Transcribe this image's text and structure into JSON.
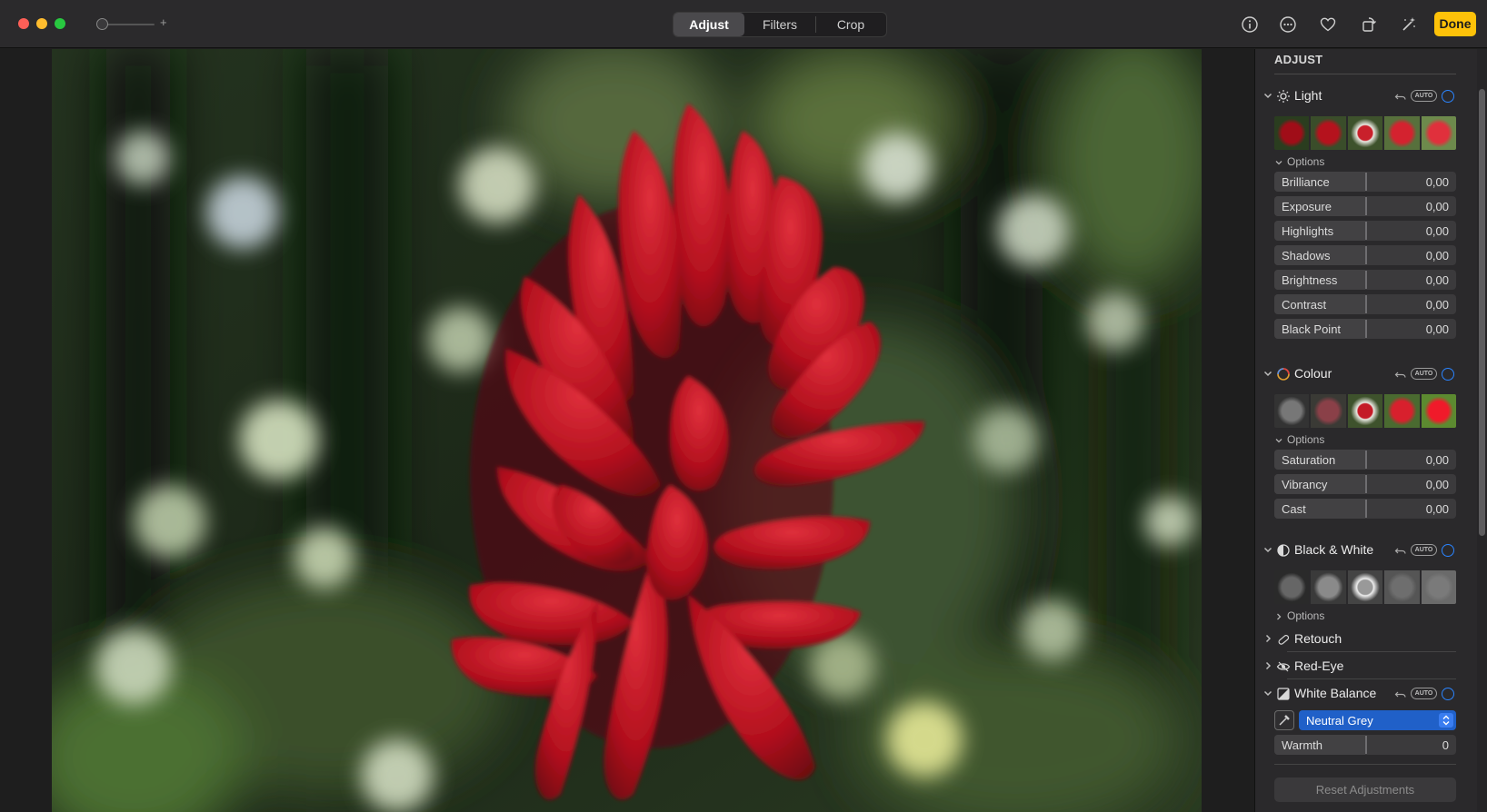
{
  "toolbar": {
    "tabs": [
      "Adjust",
      "Filters",
      "Crop"
    ],
    "active_tab": "Adjust",
    "zoom_plus": "+",
    "done_label": "Done",
    "icons": [
      "info-icon",
      "more-icon",
      "heart-icon",
      "rotate-icon",
      "magic-wand-icon"
    ]
  },
  "sidebar": {
    "header": "ADJUST",
    "light": {
      "title": "Light",
      "auto": "AUTO",
      "options": "Options",
      "sliders": [
        {
          "label": "Brilliance",
          "value": "0,00"
        },
        {
          "label": "Exposure",
          "value": "0,00"
        },
        {
          "label": "Highlights",
          "value": "0,00"
        },
        {
          "label": "Shadows",
          "value": "0,00"
        },
        {
          "label": "Brightness",
          "value": "0,00"
        },
        {
          "label": "Contrast",
          "value": "0,00"
        },
        {
          "label": "Black Point",
          "value": "0,00"
        }
      ]
    },
    "colour": {
      "title": "Colour",
      "auto": "AUTO",
      "options": "Options",
      "sliders": [
        {
          "label": "Saturation",
          "value": "0,00"
        },
        {
          "label": "Vibrancy",
          "value": "0,00"
        },
        {
          "label": "Cast",
          "value": "0,00"
        }
      ]
    },
    "bw": {
      "title": "Black & White",
      "auto": "AUTO",
      "options": "Options"
    },
    "retouch": {
      "title": "Retouch"
    },
    "redeye": {
      "title": "Red-Eye"
    },
    "white_balance": {
      "title": "White Balance",
      "auto": "AUTO",
      "preset": "Neutral Grey",
      "warmth_label": "Warmth",
      "warmth_value": "0"
    },
    "reset_label": "Reset Adjustments"
  },
  "colors": {
    "accent": "#2a84ff",
    "done": "#fec209",
    "select": "#2060c8"
  }
}
